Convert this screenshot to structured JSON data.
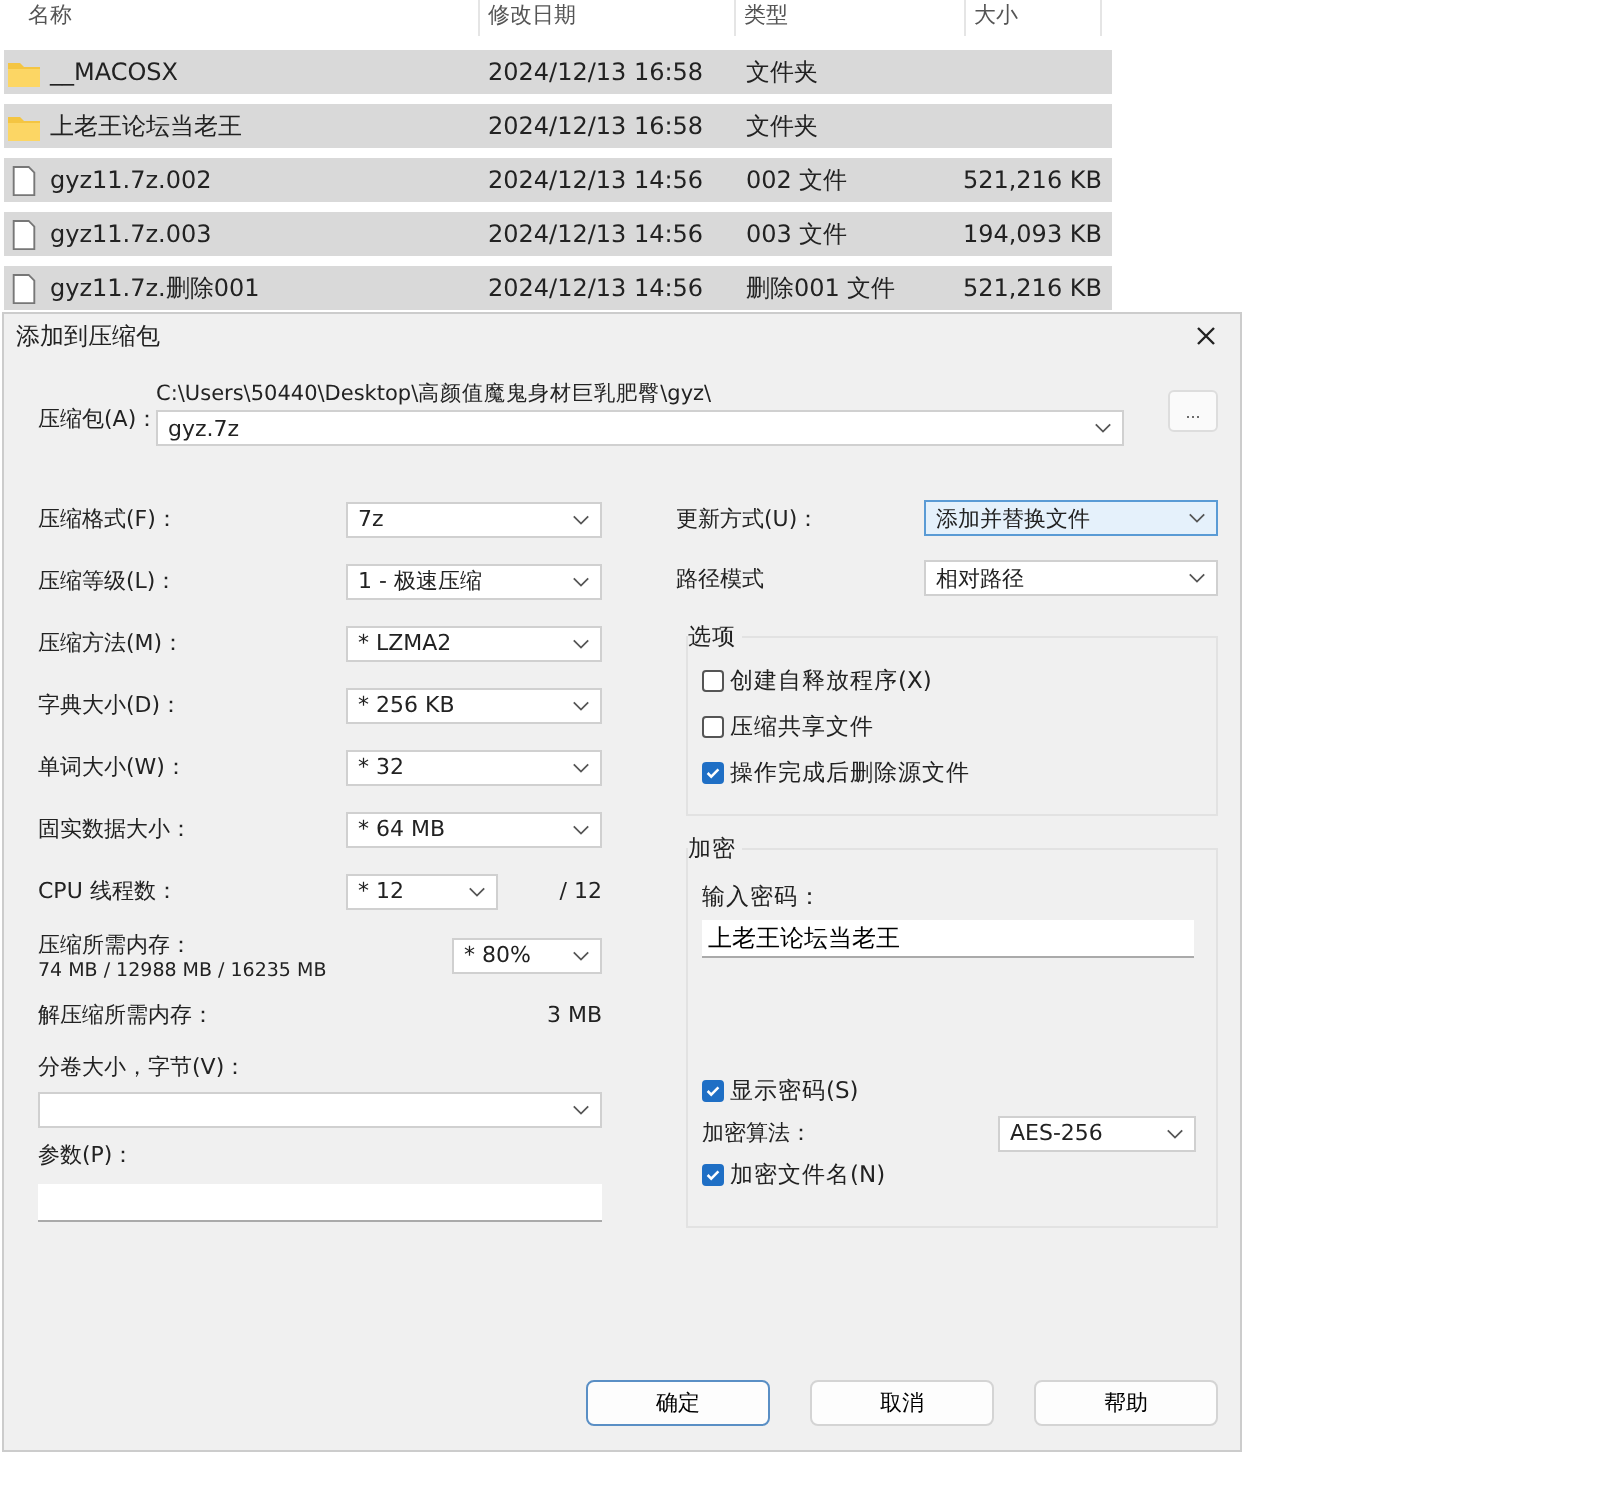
{
  "file_list": {
    "columns": [
      "名称",
      "修改日期",
      "类型",
      "大小"
    ],
    "rows": [
      {
        "kind": "folder",
        "name": "__MACOSX",
        "date": "2024/12/13 16:58",
        "type": "文件夹",
        "selected": true
      },
      {
        "kind": "folder",
        "name": "上老王论坛当老王",
        "date": "2024/12/13 16:58",
        "type": "文件夹",
        "selected": true
      },
      {
        "kind": "file",
        "name": "gyz11.7z.002",
        "date": "2024/12/13 14:56",
        "type": "002 文件",
        "size": "521,216 KB",
        "selected": true
      },
      {
        "kind": "file",
        "name": "gyz11.7z.003",
        "date": "2024/12/13 14:56",
        "type": "003 文件",
        "size": "194,093 KB",
        "selected": true
      },
      {
        "kind": "file",
        "name": "gyz11.7z.删除001",
        "date": "2024/12/13 14:56",
        "type": "删除001 文件",
        "size": "521,216 KB",
        "selected": true
      }
    ]
  },
  "dialog": {
    "title": "添加到压缩包",
    "archive": {
      "label": "压缩包(A)：",
      "path": "C:\\Users\\50440\\Desktop\\高颜值魔鬼身材巨乳肥臀\\gyz\\",
      "value": "gyz.7z",
      "browse": "..."
    },
    "left": [
      {
        "kind": "select",
        "label": "压缩格式(F)：",
        "value": "7z"
      },
      {
        "kind": "select",
        "label": "压缩等级(L)：",
        "value": "1 - 极速压缩"
      },
      {
        "kind": "select",
        "label": "压缩方法(M)：",
        "value": "* LZMA2"
      },
      {
        "kind": "select",
        "label": "字典大小(D)：",
        "value": "* 256 KB"
      },
      {
        "kind": "select",
        "label": "单词大小(W)：",
        "value": "* 32"
      },
      {
        "kind": "select",
        "label": "固实数据大小：",
        "value": "* 64 MB"
      },
      {
        "kind": "threads",
        "label": "CPU 线程数：",
        "value": "* 12",
        "total": "/ 12"
      },
      {
        "kind": "memory",
        "label": "压缩所需内存：",
        "detail": "74 MB / 12988 MB / 16235 MB",
        "value": "* 80%"
      },
      {
        "kind": "info",
        "label": "解压缩所需内存：",
        "value": "3 MB"
      }
    ],
    "volume": {
      "label": "分卷大小，字节(V)："
    },
    "params": {
      "label": "参数(P)："
    },
    "right": [
      {
        "label": "更新方式(U)：",
        "value": "添加并替换文件",
        "focused": true
      },
      {
        "label": "路径模式",
        "value": "相对路径",
        "focused": false
      }
    ],
    "options": {
      "title": "选项",
      "items": [
        {
          "label": "创建自释放程序(X)",
          "checked": false
        },
        {
          "label": "压缩共享文件",
          "checked": false
        },
        {
          "label": "操作完成后删除源文件",
          "checked": true
        }
      ]
    },
    "encryption": {
      "title": "加密",
      "password_label": "输入密码：",
      "password": "上老王论坛当老王",
      "show_password": {
        "label": "显示密码(S)",
        "checked": true
      },
      "method_label": "加密算法：",
      "method": "AES-256",
      "encrypt_names": {
        "label": "加密文件名(N)",
        "checked": true
      }
    },
    "buttons": [
      {
        "label": "确定",
        "default": true
      },
      {
        "label": "取消",
        "default": false
      },
      {
        "label": "帮助",
        "default": false
      }
    ]
  }
}
